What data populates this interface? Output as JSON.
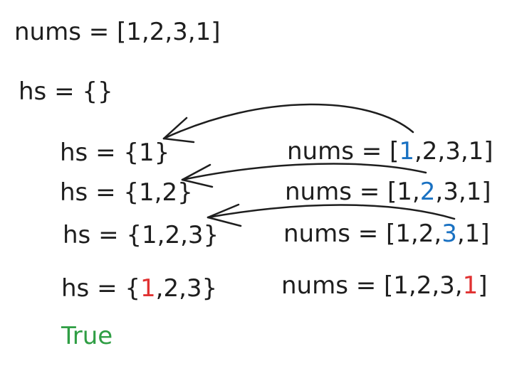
{
  "colors": {
    "ink": "#1e1e1e",
    "highlight_blue": "#1971c2",
    "highlight_red": "#e03131",
    "result_green": "#2f9e44"
  },
  "header": {
    "nums_line": "nums = [1,2,3,1]",
    "hs_init": "hs = {}"
  },
  "steps": [
    {
      "hs_pre": "hs = {",
      "hs_mark": "",
      "hs_post": "1}",
      "nums_pre": "nums = [",
      "nums_mark": "1",
      "nums_post": ",2,3,1]"
    },
    {
      "hs_pre": "hs = {",
      "hs_mark": "",
      "hs_post": "1,2}",
      "nums_pre": "nums = [1,",
      "nums_mark": "2",
      "nums_post": ",3,1]"
    },
    {
      "hs_pre": "hs = {",
      "hs_mark": "",
      "hs_post": "1,2,3}",
      "nums_pre": "nums = [1,2,",
      "nums_mark": "3",
      "nums_post": ",1]"
    },
    {
      "hs_pre": "hs = {",
      "hs_mark": "1",
      "hs_post": ",2,3}",
      "nums_pre": "nums = [1,2,3,",
      "nums_mark": "1",
      "nums_post": "]"
    }
  ],
  "result": "True"
}
